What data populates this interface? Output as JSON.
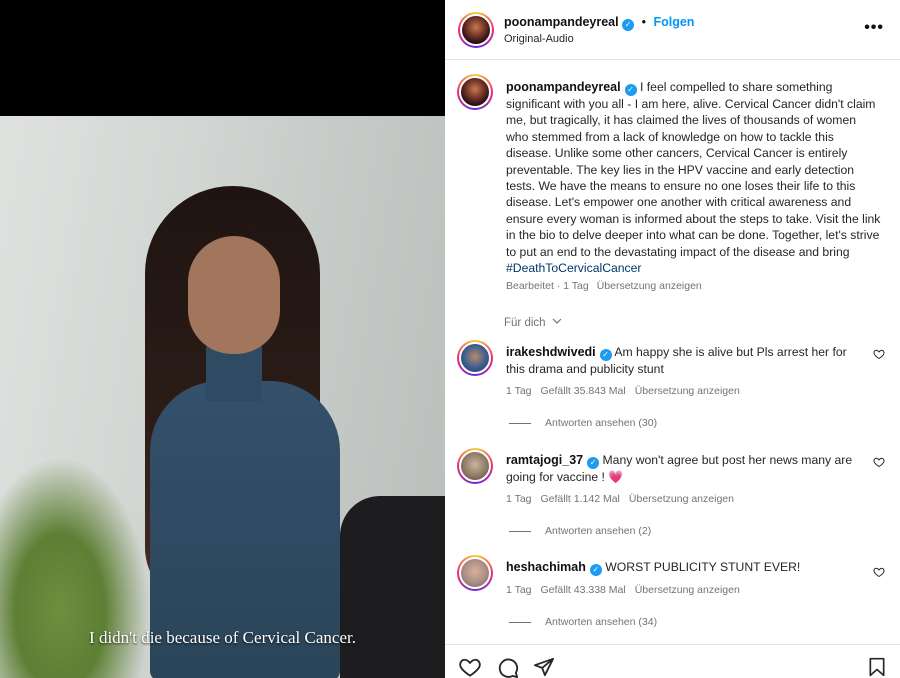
{
  "video": {
    "subtitle": "I didn't die because of Cervical Cancer."
  },
  "header": {
    "username": "poonampandeyreal",
    "separator": "•",
    "follow_label": "Folgen",
    "audio": "Original-Audio",
    "more_icon": "more-horizontal-icon",
    "more_glyph": "•••"
  },
  "caption": {
    "username": "poonampandeyreal",
    "text": "I feel compelled to share something significant with you all - I am here, alive. Cervical Cancer didn't claim me, but tragically, it has claimed the lives of thousands of women who stemmed from a lack of knowledge on how to tackle this disease. Unlike some other cancers, Cervical Cancer is entirely preventable. The key lies in the HPV vaccine and early detection tests. We have the means to ensure no one loses their life to this disease. Let's empower one another with critical awareness and ensure every woman is informed about the steps to take. Visit the link in the bio to delve deeper into what can be done. Together, let's strive to put an end to the devastating impact of the disease and bring",
    "hashtag": "#DeathToCervicalCancer",
    "edited": "Bearbeitet · 1 Tag",
    "translate": "Übersetzung anzeigen"
  },
  "for_you": "Für dich",
  "comments": [
    {
      "username": "irakeshdwivedi",
      "text": "Am happy she is alive but Pls arrest her for this drama and publicity stunt",
      "time": "1 Tag",
      "likes": "Gefällt 35.843 Mal",
      "translate": "Übersetzung anzeigen",
      "replies": "Antworten ansehen (30)"
    },
    {
      "username": "ramtajogi_37",
      "text": "Many won't agree but post her news many are going for vaccine !",
      "emoji": "💗",
      "time": "1 Tag",
      "likes": "Gefällt 1.142 Mal",
      "translate": "Übersetzung anzeigen",
      "replies": "Antworten ansehen (2)"
    },
    {
      "username": "heshachimah",
      "text": "WORST PUBLICITY STUNT EVER!",
      "time": "1 Tag",
      "likes": "Gefällt 43.338 Mal",
      "translate": "Übersetzung anzeigen",
      "replies": "Antworten ansehen (34)"
    }
  ],
  "verified_glyph": "✓",
  "colors": {
    "link_blue": "#0095f6",
    "verified_blue": "#1d9bf0",
    "hashtag": "#00376b",
    "secondary_text": "#737373"
  },
  "icons": {
    "like": "heart-icon",
    "comment": "comment-icon",
    "share": "share-icon",
    "save": "bookmark-icon"
  }
}
